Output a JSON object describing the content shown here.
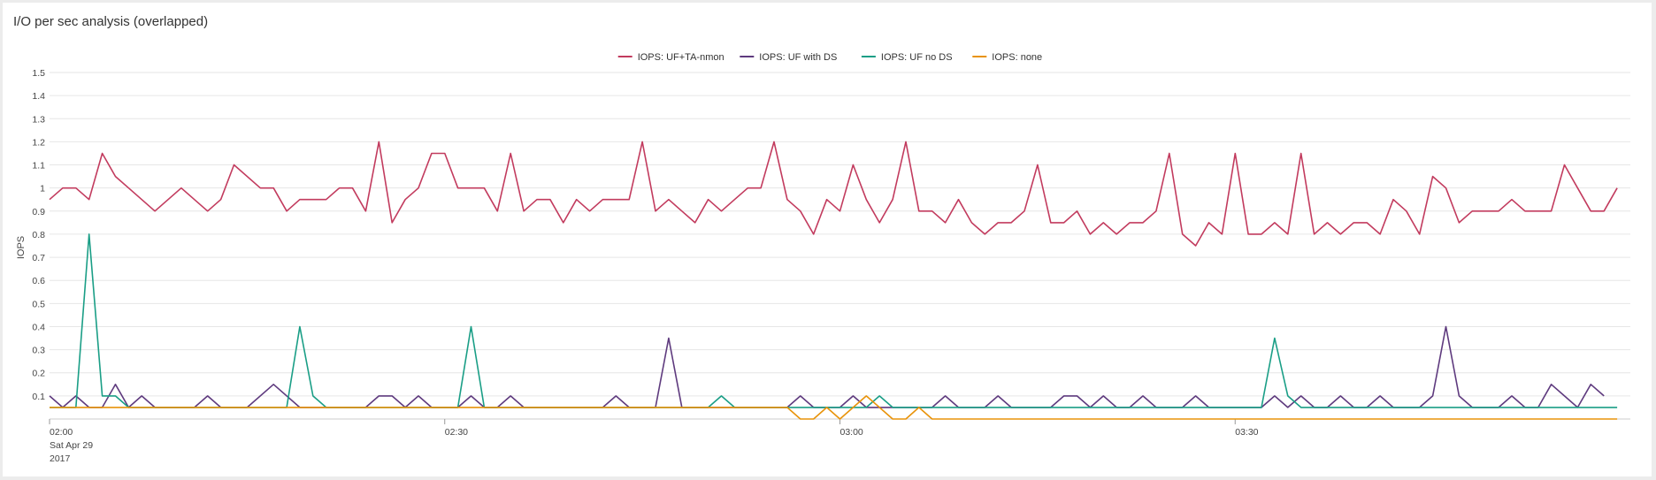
{
  "panel": {
    "title": "I/O per sec analysis (overlapped)"
  },
  "chart_data": {
    "type": "line",
    "ylabel": "IOPS",
    "ylim": [
      0,
      1.5
    ],
    "y_ticks": [
      "0.1",
      "0.2",
      "0.3",
      "0.4",
      "0.5",
      "0.6",
      "0.7",
      "0.8",
      "0.9",
      "1",
      "1.1",
      "1.2",
      "1.3",
      "1.4",
      "1.5"
    ],
    "x_start": "02:00",
    "x_end": "04:00",
    "x_ticks": [
      {
        "t": "02:00",
        "label": "02:00",
        "sub": [
          "Sat Apr 29",
          "2017"
        ]
      },
      {
        "t": "02:30",
        "label": "02:30",
        "sub": []
      },
      {
        "t": "03:00",
        "label": "03:00",
        "sub": []
      },
      {
        "t": "03:30",
        "label": "03:30",
        "sub": []
      }
    ],
    "legend_position": "top-center",
    "grid": true,
    "series": [
      {
        "name": "IOPS: UF+TA-nmon",
        "color": "#c23b5e",
        "points": [
          [
            "02:00",
            0.95
          ],
          [
            "02:01",
            1.0
          ],
          [
            "02:02",
            1.0
          ],
          [
            "02:03",
            0.95
          ],
          [
            "02:04",
            1.15
          ],
          [
            "02:05",
            1.05
          ],
          [
            "02:06",
            1.0
          ],
          [
            "02:07",
            0.95
          ],
          [
            "02:08",
            0.9
          ],
          [
            "02:10",
            1.0
          ],
          [
            "02:12",
            0.9
          ],
          [
            "02:13",
            0.95
          ],
          [
            "02:14",
            1.1
          ],
          [
            "02:16",
            1.0
          ],
          [
            "02:17",
            1.0
          ],
          [
            "02:18",
            0.9
          ],
          [
            "02:19",
            0.95
          ],
          [
            "02:20",
            0.95
          ],
          [
            "02:21",
            0.95
          ],
          [
            "02:22",
            1.0
          ],
          [
            "02:23",
            1.0
          ],
          [
            "02:24",
            0.9
          ],
          [
            "02:25",
            1.2
          ],
          [
            "02:26",
            0.85
          ],
          [
            "02:27",
            0.95
          ],
          [
            "02:28",
            1.0
          ],
          [
            "02:29",
            1.15
          ],
          [
            "02:30",
            1.15
          ],
          [
            "02:31",
            1.0
          ],
          [
            "02:32",
            1.0
          ],
          [
            "02:33",
            1.0
          ],
          [
            "02:34",
            0.9
          ],
          [
            "02:35",
            1.15
          ],
          [
            "02:36",
            0.9
          ],
          [
            "02:37",
            0.95
          ],
          [
            "02:38",
            0.95
          ],
          [
            "02:39",
            0.85
          ],
          [
            "02:40",
            0.95
          ],
          [
            "02:41",
            0.9
          ],
          [
            "02:42",
            0.95
          ],
          [
            "02:43",
            0.95
          ],
          [
            "02:44",
            0.95
          ],
          [
            "02:45",
            1.2
          ],
          [
            "02:46",
            0.9
          ],
          [
            "02:47",
            0.95
          ],
          [
            "02:48",
            0.9
          ],
          [
            "02:49",
            0.85
          ],
          [
            "02:50",
            0.95
          ],
          [
            "02:51",
            0.9
          ],
          [
            "02:52",
            0.95
          ],
          [
            "02:53",
            1.0
          ],
          [
            "02:54",
            1.0
          ],
          [
            "02:55",
            1.2
          ],
          [
            "02:56",
            0.95
          ],
          [
            "02:57",
            0.9
          ],
          [
            "02:58",
            0.8
          ],
          [
            "02:59",
            0.95
          ],
          [
            "03:00",
            0.9
          ],
          [
            "03:01",
            1.1
          ],
          [
            "03:02",
            0.95
          ],
          [
            "03:03",
            0.85
          ],
          [
            "03:04",
            0.95
          ],
          [
            "03:05",
            1.2
          ],
          [
            "03:06",
            0.9
          ],
          [
            "03:07",
            0.9
          ],
          [
            "03:08",
            0.85
          ],
          [
            "03:09",
            0.95
          ],
          [
            "03:10",
            0.85
          ],
          [
            "03:11",
            0.8
          ],
          [
            "03:12",
            0.85
          ],
          [
            "03:13",
            0.85
          ],
          [
            "03:14",
            0.9
          ],
          [
            "03:15",
            1.1
          ],
          [
            "03:16",
            0.85
          ],
          [
            "03:17",
            0.85
          ],
          [
            "03:18",
            0.9
          ],
          [
            "03:19",
            0.8
          ],
          [
            "03:20",
            0.85
          ],
          [
            "03:21",
            0.8
          ],
          [
            "03:22",
            0.85
          ],
          [
            "03:23",
            0.85
          ],
          [
            "03:24",
            0.9
          ],
          [
            "03:25",
            1.15
          ],
          [
            "03:26",
            0.8
          ],
          [
            "03:27",
            0.75
          ],
          [
            "03:28",
            0.85
          ],
          [
            "03:29",
            0.8
          ],
          [
            "03:30",
            1.15
          ],
          [
            "03:31",
            0.8
          ],
          [
            "03:32",
            0.8
          ],
          [
            "03:33",
            0.85
          ],
          [
            "03:34",
            0.8
          ],
          [
            "03:35",
            1.15
          ],
          [
            "03:36",
            0.8
          ],
          [
            "03:37",
            0.85
          ],
          [
            "03:38",
            0.8
          ],
          [
            "03:39",
            0.85
          ],
          [
            "03:40",
            0.85
          ],
          [
            "03:41",
            0.8
          ],
          [
            "03:42",
            0.95
          ],
          [
            "03:43",
            0.9
          ],
          [
            "03:44",
            0.8
          ],
          [
            "03:45",
            1.05
          ],
          [
            "03:46",
            1.0
          ],
          [
            "03:47",
            0.85
          ],
          [
            "03:48",
            0.9
          ],
          [
            "03:49",
            0.9
          ],
          [
            "03:50",
            0.9
          ],
          [
            "03:51",
            0.95
          ],
          [
            "03:52",
            0.9
          ],
          [
            "03:53",
            0.9
          ],
          [
            "03:54",
            0.9
          ],
          [
            "03:55",
            1.1
          ],
          [
            "03:56",
            1.0
          ],
          [
            "03:57",
            0.9
          ],
          [
            "03:58",
            0.9
          ],
          [
            "03:59",
            1.0
          ]
        ]
      },
      {
        "name": "IOPS: UF with DS",
        "color": "#5e3a7e",
        "points": [
          [
            "02:00",
            0.1
          ],
          [
            "02:01",
            0.05
          ],
          [
            "02:02",
            0.1
          ],
          [
            "02:03",
            0.05
          ],
          [
            "02:04",
            0.05
          ],
          [
            "02:05",
            0.15
          ],
          [
            "02:06",
            0.05
          ],
          [
            "02:07",
            0.1
          ],
          [
            "02:08",
            0.05
          ],
          [
            "02:10",
            0.05
          ],
          [
            "02:11",
            0.05
          ],
          [
            "02:12",
            0.1
          ],
          [
            "02:13",
            0.05
          ],
          [
            "02:15",
            0.05
          ],
          [
            "02:17",
            0.15
          ],
          [
            "02:19",
            0.05
          ],
          [
            "02:20",
            0.05
          ],
          [
            "02:24",
            0.05
          ],
          [
            "02:25",
            0.1
          ],
          [
            "02:26",
            0.1
          ],
          [
            "02:27",
            0.05
          ],
          [
            "02:28",
            0.1
          ],
          [
            "02:29",
            0.05
          ],
          [
            "02:30",
            0.05
          ],
          [
            "02:31",
            0.05
          ],
          [
            "02:32",
            0.1
          ],
          [
            "02:33",
            0.05
          ],
          [
            "02:34",
            0.05
          ],
          [
            "02:35",
            0.1
          ],
          [
            "02:36",
            0.05
          ],
          [
            "02:42",
            0.05
          ],
          [
            "02:43",
            0.1
          ],
          [
            "02:44",
            0.05
          ],
          [
            "02:46",
            0.05
          ],
          [
            "02:47",
            0.35
          ],
          [
            "02:48",
            0.05
          ],
          [
            "02:55",
            0.05
          ],
          [
            "02:56",
            0.05
          ],
          [
            "02:57",
            0.1
          ],
          [
            "02:58",
            0.05
          ],
          [
            "03:00",
            0.05
          ],
          [
            "03:01",
            0.1
          ],
          [
            "03:02",
            0.05
          ],
          [
            "03:06",
            0.05
          ],
          [
            "03:07",
            0.05
          ],
          [
            "03:08",
            0.1
          ],
          [
            "03:09",
            0.05
          ],
          [
            "03:11",
            0.05
          ],
          [
            "03:12",
            0.1
          ],
          [
            "03:13",
            0.05
          ],
          [
            "03:16",
            0.05
          ],
          [
            "03:17",
            0.1
          ],
          [
            "03:18",
            0.1
          ],
          [
            "03:19",
            0.05
          ],
          [
            "03:20",
            0.1
          ],
          [
            "03:21",
            0.05
          ],
          [
            "03:22",
            0.05
          ],
          [
            "03:23",
            0.1
          ],
          [
            "03:24",
            0.05
          ],
          [
            "03:26",
            0.05
          ],
          [
            "03:27",
            0.1
          ],
          [
            "03:28",
            0.05
          ],
          [
            "03:32",
            0.05
          ],
          [
            "03:33",
            0.1
          ],
          [
            "03:34",
            0.05
          ],
          [
            "03:35",
            0.1
          ],
          [
            "03:36",
            0.05
          ],
          [
            "03:37",
            0.05
          ],
          [
            "03:38",
            0.1
          ],
          [
            "03:39",
            0.05
          ],
          [
            "03:40",
            0.05
          ],
          [
            "03:41",
            0.1
          ],
          [
            "03:42",
            0.05
          ],
          [
            "03:44",
            0.05
          ],
          [
            "03:45",
            0.1
          ],
          [
            "03:46",
            0.4
          ],
          [
            "03:47",
            0.1
          ],
          [
            "03:48",
            0.05
          ],
          [
            "03:50",
            0.05
          ],
          [
            "03:51",
            0.1
          ],
          [
            "03:52",
            0.05
          ],
          [
            "03:53",
            0.05
          ],
          [
            "03:54",
            0.15
          ],
          [
            "03:55",
            0.1
          ],
          [
            "03:56",
            0.05
          ],
          [
            "03:57",
            0.15
          ],
          [
            "03:58",
            0.1
          ]
        ]
      },
      {
        "name": "IOPS: UF no DS",
        "color": "#1a9e86",
        "points": [
          [
            "02:00",
            0.05
          ],
          [
            "02:01",
            0.05
          ],
          [
            "02:02",
            0.05
          ],
          [
            "02:03",
            0.8
          ],
          [
            "02:04",
            0.1
          ],
          [
            "02:05",
            0.1
          ],
          [
            "02:06",
            0.05
          ],
          [
            "02:18",
            0.05
          ],
          [
            "02:19",
            0.4
          ],
          [
            "02:20",
            0.1
          ],
          [
            "02:21",
            0.05
          ],
          [
            "02:31",
            0.05
          ],
          [
            "02:32",
            0.4
          ],
          [
            "02:33",
            0.05
          ],
          [
            "02:50",
            0.05
          ],
          [
            "02:51",
            0.1
          ],
          [
            "02:52",
            0.05
          ],
          [
            "03:02",
            0.05
          ],
          [
            "03:03",
            0.1
          ],
          [
            "03:04",
            0.05
          ],
          [
            "03:32",
            0.05
          ],
          [
            "03:33",
            0.35
          ],
          [
            "03:34",
            0.1
          ],
          [
            "03:35",
            0.05
          ],
          [
            "03:59",
            0.05
          ]
        ]
      },
      {
        "name": "IOPS: none",
        "color": "#e8930a",
        "points": [
          [
            "02:00",
            0.05
          ],
          [
            "02:56",
            0.05
          ],
          [
            "02:57",
            0.0
          ],
          [
            "02:58",
            0.0
          ],
          [
            "02:59",
            0.05
          ],
          [
            "03:00",
            0.0
          ],
          [
            "03:01",
            0.05
          ],
          [
            "03:02",
            0.1
          ],
          [
            "03:03",
            0.05
          ],
          [
            "03:04",
            0.0
          ],
          [
            "03:05",
            0.0
          ],
          [
            "03:06",
            0.05
          ],
          [
            "03:07",
            0.0
          ],
          [
            "03:59",
            0.0
          ]
        ]
      }
    ]
  }
}
